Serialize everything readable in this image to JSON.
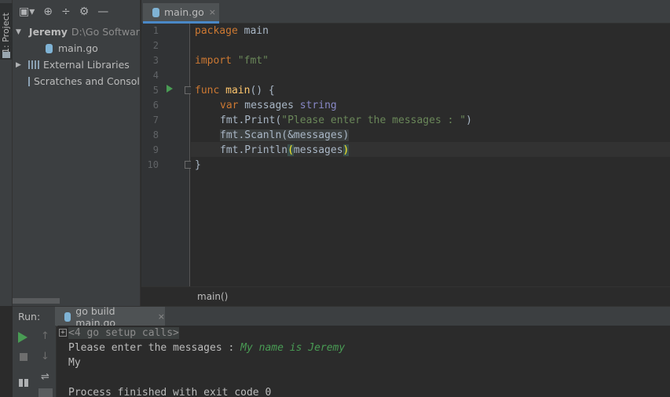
{
  "stripe": {
    "label": "1: Project"
  },
  "project": {
    "tree": {
      "root_name": "Jeremy",
      "root_path": "D:\\Go Software",
      "file": "main.go",
      "external_libraries": "External Libraries",
      "scratches": "Scratches and Consoles"
    }
  },
  "editor": {
    "tab_label": "main.go",
    "tab_close": "×",
    "line_numbers": [
      "1",
      "2",
      "3",
      "4",
      "5",
      "6",
      "7",
      "8",
      "9",
      "10"
    ],
    "code": {
      "l1_kw": "package",
      "l1_rest": " main",
      "l3_kw": "import",
      "l3_str": "\"fmt\"",
      "l5_kw": "func",
      "l5_fn": "main",
      "l5_rest": "() {",
      "l6_kw": "var",
      "l6_ident": " messages ",
      "l6_type": "string",
      "l7_call": "fmt.Print(",
      "l7_str": "\"Please enter the messages : \"",
      "l7_close": ")",
      "l8_text": "fmt.Scanln(&messages)",
      "l9_call": "fmt.Println",
      "l9_open": "(",
      "l9_arg": "messages",
      "l9_close": ")",
      "l10_text": "}"
    },
    "breadcrumb": "main()"
  },
  "run": {
    "title": "Run:",
    "tab_label": "go build main.go",
    "tab_close": "×",
    "console": {
      "setup_calls": "<4 go setup calls>",
      "prompt": "Please enter the messages : ",
      "user_input": "My name is Jeremy",
      "output": "My",
      "exit": "Process finished with exit code 0"
    }
  }
}
